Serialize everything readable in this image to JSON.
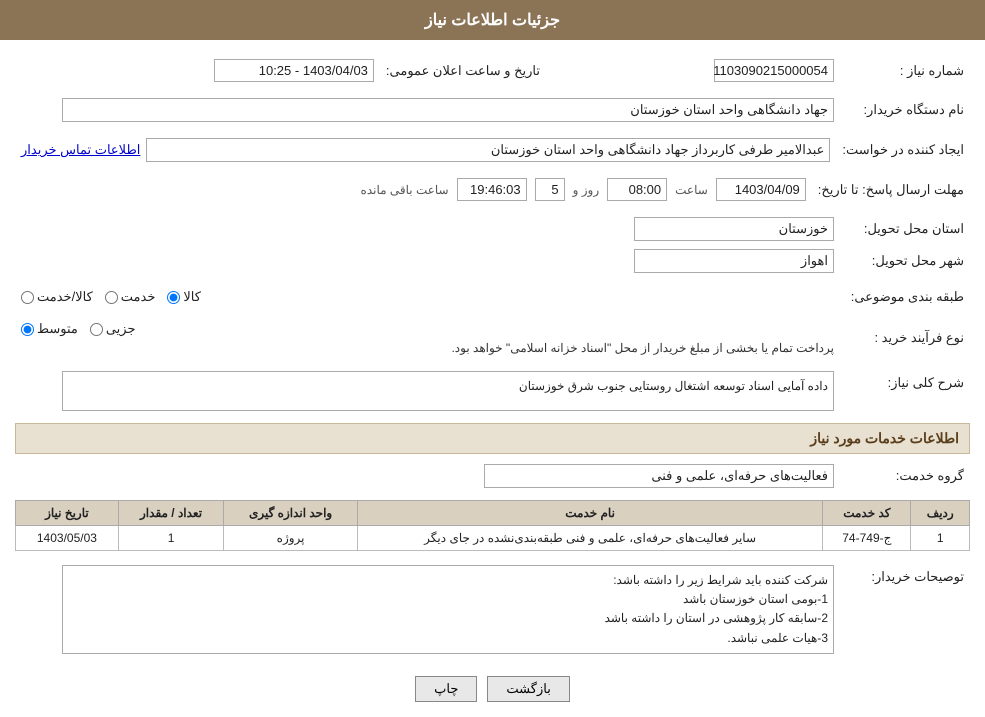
{
  "page": {
    "title": "جزئیات اطلاعات نیاز"
  },
  "header": {
    "title": "جزئیات اطلاعات نیاز"
  },
  "fields": {
    "shomare_niaz_label": "شماره نیاز :",
    "shomare_niaz_value": "1103090215000054",
    "name_dastgah_label": "نام دستگاه خریدار:",
    "name_dastgah_value": "جهاد دانشگاهی واحد استان خوزستان",
    "ijad_konande_label": "ایجاد کننده در خواست:",
    "ijad_konande_value": "عبدالامیر طرفی کاربرداز جهاد دانشگاهی واحد استان خوزستان",
    "mohlat_label": "مهلت ارسال پاسخ: تا تاریخ:",
    "mohlat_date": "1403/04/09",
    "mohlat_saat_label": "ساعت",
    "mohlat_saat": "08:00",
    "mohlat_roz_label": "روز و",
    "mohlat_roz": "5",
    "mohlat_baqi_label": "ساعت باقی مانده",
    "mohlat_baqi": "19:46:03",
    "tarikh_label": "تاریخ و ساعت اعلان عمومی:",
    "tarikh_value": "1403/04/03 - 10:25",
    "ostan_tahvil_label": "استان محل تحویل:",
    "ostan_tahvil_value": "خوزستان",
    "shahr_tahvil_label": "شهر محل تحویل:",
    "shahr_tahvil_value": "اهواز",
    "tabaqebandi_label": "طبقه بندی موضوعی:",
    "tabaqebandi_options": [
      "کالا",
      "خدمت",
      "کالا/خدمت"
    ],
    "tabaqebandi_selected": "کالا",
    "noe_farayand_label": "نوع فرآیند خرید :",
    "noe_farayand_options": [
      "جزیی",
      "متوسط"
    ],
    "noe_farayand_selected": "متوسط",
    "noe_farayand_note": "پرداخت تمام یا بخشی از مبلغ خریدار از محل \"اسناد خزانه اسلامی\" خواهد بود.",
    "sharh_label": "شرح کلی نیاز:",
    "sharh_value": "داده آمایی اسناد توسعه اشتغال روستایی جنوب شرق خوزستان",
    "khadamat_section": "اطلاعات خدمات مورد نیاز",
    "gorohe_khadamat_label": "گروه خدمت:",
    "gorohe_khadamat_value": "فعالیت‌های حرفه‌ای، علمی و فنی",
    "aatelaat_contact": "اطلاعات تماس خریدار",
    "table": {
      "headers": [
        "ردیف",
        "کد خدمت",
        "نام خدمت",
        "واحد اندازه گیری",
        "تعداد / مقدار",
        "تاریخ نیاز"
      ],
      "rows": [
        {
          "radif": "1",
          "kod": "ج-749-74",
          "nam": "سایر فعالیت‌های حرفه‌ای، علمی و فنی طبقه‌بندی‌نشده در جای دیگر",
          "vahed": "پروژه",
          "tedad": "1",
          "tarikh": "1403/05/03"
        }
      ]
    },
    "toseye_label": "توصیحات خریدار:",
    "toseye_value": "شرکت کننده باید شرایط زیر را داشته باشد:\n1-بومی استان خوزستان باشد\n2-سابقه کار پژوهشی در استان را داشته باشد\n3-هیات علمی نباشد.",
    "btn_print": "چاپ",
    "btn_back": "بازگشت"
  }
}
